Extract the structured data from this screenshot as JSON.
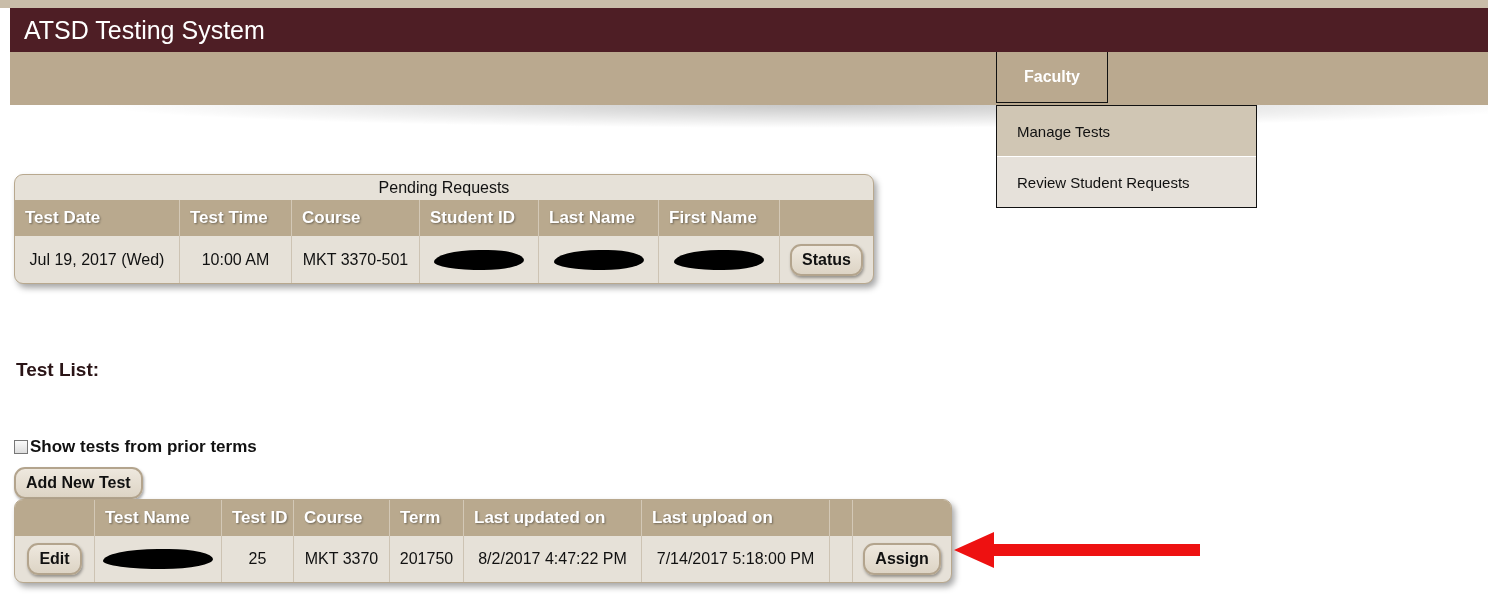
{
  "app": {
    "title": "ATSD Testing System"
  },
  "nav": {
    "menus": [
      {
        "label": "Faculty",
        "expanded": true,
        "items": [
          {
            "label": "Manage Tests",
            "selected": true
          },
          {
            "label": "Review Student Requests",
            "selected": false
          }
        ]
      }
    ]
  },
  "pending_requests": {
    "title": "Pending Requests",
    "columns": [
      {
        "kind": "label",
        "label": "Test Date"
      },
      {
        "kind": "label",
        "label": "Test Time"
      },
      {
        "kind": "label",
        "label": "Course"
      },
      {
        "kind": "label",
        "label": "Student ID"
      },
      {
        "kind": "label",
        "label": "Last Name"
      },
      {
        "kind": "label",
        "label": "First Name"
      },
      {
        "kind": "blank"
      }
    ],
    "rows": [
      {
        "cells": [
          {
            "kind": "text",
            "text": "Jul 19, 2017 (Wed)"
          },
          {
            "kind": "text",
            "text": "10:00 AM"
          },
          {
            "kind": "text",
            "text": "MKT 3370-501"
          },
          {
            "kind": "redacted"
          },
          {
            "kind": "redacted"
          },
          {
            "kind": "redacted"
          },
          {
            "kind": "button",
            "text": "Status"
          }
        ]
      }
    ]
  },
  "test_list": {
    "heading": "Test List:",
    "show_prior_terms": {
      "label": "Show tests from prior terms",
      "checked": false
    },
    "add_button": "Add New Test",
    "columns": [
      {
        "kind": "blank"
      },
      {
        "kind": "label",
        "label": "Test Name"
      },
      {
        "kind": "label",
        "label": "Test ID"
      },
      {
        "kind": "label",
        "label": "Course"
      },
      {
        "kind": "label",
        "label": "Term"
      },
      {
        "kind": "label",
        "label": "Last updated on"
      },
      {
        "kind": "label",
        "label": "Last upload on"
      },
      {
        "kind": "blank"
      },
      {
        "kind": "blank"
      }
    ],
    "rows": [
      {
        "cells": [
          {
            "kind": "button",
            "text": "Edit"
          },
          {
            "kind": "redacted"
          },
          {
            "kind": "text",
            "text": "25"
          },
          {
            "kind": "text",
            "text": "MKT 3370"
          },
          {
            "kind": "text",
            "text": "201750"
          },
          {
            "kind": "text",
            "text": "8/2/2017 4:47:22 PM"
          },
          {
            "kind": "text",
            "text": "7/14/2017 5:18:00 PM"
          },
          {
            "kind": "empty"
          },
          {
            "kind": "button",
            "text": "Assign"
          }
        ]
      }
    ]
  }
}
